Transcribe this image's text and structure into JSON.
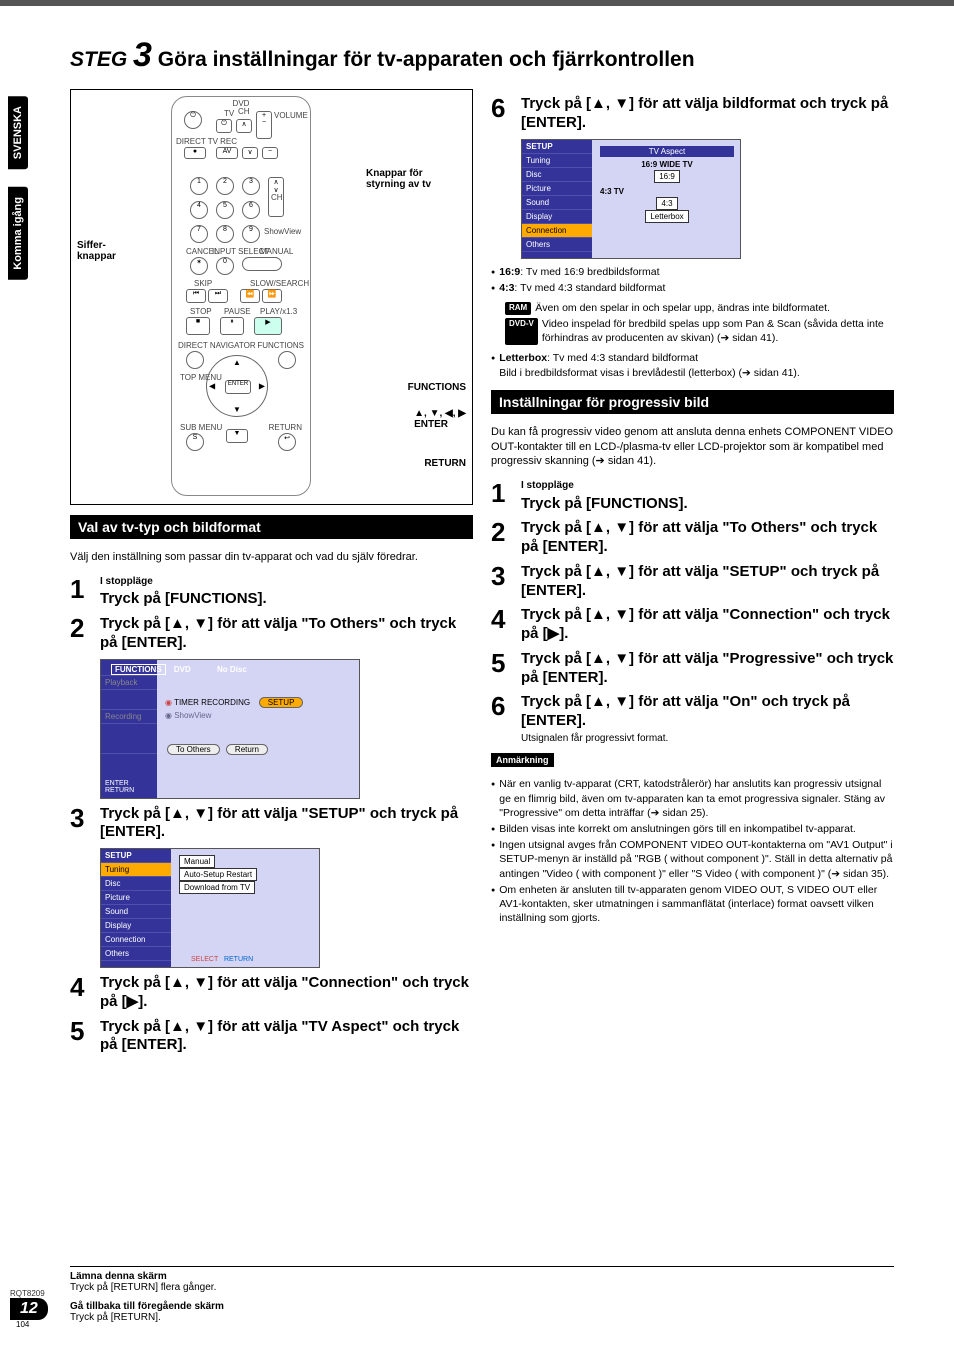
{
  "sideTabs": [
    "SVENSKA",
    "Komma igång"
  ],
  "title": {
    "steg": "STEG",
    "num": "3",
    "rest": "Göra inställningar för tv-apparaten och fjärrkontrollen"
  },
  "remote": {
    "calloutSiffer": "Siffer-\nknappar",
    "calloutTv": "Knappar för\nstyrning av tv",
    "btnFunctions": "FUNCTIONS",
    "btnArrows": "▲, ▼, ◀, ▶\nENTER",
    "btnReturn": "RETURN",
    "labels": {
      "dvd": "DVD",
      "tv": "TV",
      "volume": "VOLUME",
      "ch": "CH",
      "directTvRec": "DIRECT TV REC",
      "av": "AV",
      "showview": "ShowView",
      "cancel": "CANCEL",
      "inputSelect": "INPUT SELECT",
      "manualSkip": "MANUAL SKIP",
      "skip": "SKIP",
      "slow": "SLOW/SEARCH",
      "stop": "STOP",
      "pause": "PAUSE",
      "play": "PLAY/x1.3",
      "directNav": "DIRECT NAVIGATOR",
      "functions": "FUNCTIONS",
      "topMenu": "TOP MENU",
      "subMenu": "SUB MENU",
      "return": "RETURN",
      "enter": "ENTER",
      "s": "S"
    }
  },
  "section1": {
    "head": "Val av tv-typ och bildformat",
    "intro": "Välj den inställning som passar din tv-apparat och vad du själv föredrar."
  },
  "stepsLeft": {
    "s1small": "I stoppläge",
    "s1main": "Tryck på [FUNCTIONS].",
    "s2": "Tryck på [▲, ▼] för att välja \"To Others\" och tryck på [ENTER].",
    "s3": "Tryck på [▲, ▼] för att välja \"SETUP\" och tryck på [ENTER].",
    "s4": "Tryck på [▲, ▼] för att välja \"Connection\" och tryck på [▶].",
    "s5": "Tryck på [▲, ▼] för att välja \"TV Aspect\" och tryck på [ENTER]."
  },
  "menuShot1": {
    "topLeft": "FUNCTIONS",
    "topMid": "DVD",
    "topRight": "No Disc",
    "items": [
      "Playback",
      "Recording",
      "TIMER RECORDING",
      "SETUP",
      "ShowView"
    ],
    "pills": [
      "To Others",
      "Return"
    ],
    "hint": "ENTER\nRETURN"
  },
  "menuShot2": {
    "setup": "SETUP",
    "sidebar": [
      "Tuning",
      "Disc",
      "Picture",
      "Sound",
      "Display",
      "Connection",
      "Others"
    ],
    "main": [
      "Manual",
      "Auto-Setup Restart",
      "Download from TV"
    ],
    "hintSelect": "SELECT",
    "hintReturn": "RETURN"
  },
  "step6": {
    "title": "Tryck på [▲, ▼] för att välja bildformat och tryck på [ENTER].",
    "menu": {
      "setup": "SETUP",
      "aspect": "TV Aspect",
      "sidebar": [
        "Tuning",
        "Disc",
        "Picture",
        "Sound",
        "Display",
        "Connection",
        "Others"
      ],
      "main": [
        "16:9 WIDE TV",
        "16:9",
        "4:3 TV",
        "4:3",
        "Letterbox"
      ]
    },
    "bullets": {
      "b1l": "16:9",
      "b1t": ": Tv med 16:9 bredbildsformat",
      "b2l": "4:3",
      "b2t": ": Tv med 4:3 standard bildformat",
      "ram": "RAM",
      "ramt": "Även om den spelar in och spelar upp, ändras inte bildformatet.",
      "dvdv": "DVD-V",
      "dvdvt": "Video inspelad för bredbild spelas upp som Pan & Scan (såvida detta inte förhindras av producenten av skivan) (➔ sidan 41).",
      "b3l": "Letterbox",
      "b3t": ": Tv med 4:3 standard bildformat",
      "b3t2": "Bild i bredbildsformat visas i brevlådestil (letterbox) (➔ sidan 41)."
    }
  },
  "section2": {
    "head": "Inställningar för progressiv bild",
    "intro": "Du kan få progressiv video genom att ansluta denna enhets COMPONENT VIDEO OUT-kontakter till en LCD-/plasma-tv eller LCD-projektor som är kompatibel med progressiv skanning (➔ sidan 41)."
  },
  "stepsRight": {
    "s1small": "I stoppläge",
    "s1main": "Tryck på [FUNCTIONS].",
    "s2": "Tryck på [▲, ▼] för att välja \"To Others\" och tryck på [ENTER].",
    "s3": "Tryck på [▲, ▼] för att välja \"SETUP\" och tryck på [ENTER].",
    "s4": "Tryck på [▲, ▼] för att välja \"Connection\" och tryck på [▶].",
    "s5": "Tryck på [▲, ▼] för att välja \"Progressive\" och tryck på [ENTER].",
    "s6": "Tryck på [▲, ▼] för att välja \"On\" och tryck på [ENTER].",
    "s6note": "Utsignalen får progressivt format."
  },
  "anm": {
    "label": "Anmärkning",
    "b1": "När en vanlig tv-apparat (CRT, katodstrålerör) har anslutits kan progressiv utsignal ge en flimrig bild, även om tv-apparaten kan ta emot progressiva signaler. Stäng av \"Progressive\" om detta inträffar (➔ sidan 25).",
    "b2": "Bilden visas inte korrekt om anslutningen görs till en inkompatibel tv-apparat.",
    "b3": "Ingen utsignal avges från COMPONENT VIDEO OUT-kontakterna om \"AV1 Output\" i SETUP-menyn är inställd på \"RGB ( without component )\". Ställ in detta alternativ på antingen \"Video ( with component )\" eller \"S Video ( with component )\" (➔ sidan 35).",
    "b4": "Om enheten är ansluten till tv-apparaten genom VIDEO OUT, S VIDEO OUT eller AV1-kontakten, sker utmatningen i sammanflätat (interlace) format oavsett vilken inställning som gjorts."
  },
  "footer": {
    "l1b": "Lämna denna skärm",
    "l1": "Tryck på [RETURN] flera gånger.",
    "l2b": "Gå tillbaka till föregående skärm",
    "l2": "Tryck på [RETURN]."
  },
  "pageInfo": {
    "rqt": "RQT8209",
    "pn": "12",
    "tiny": "104"
  }
}
